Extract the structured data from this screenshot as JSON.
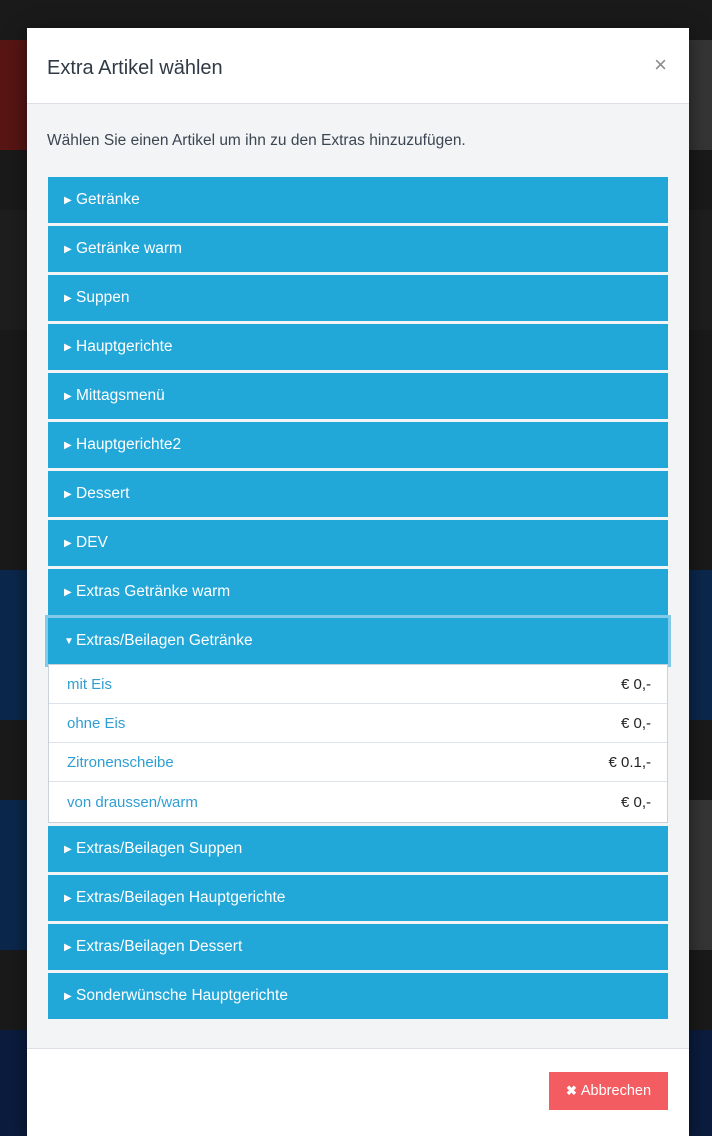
{
  "modal": {
    "title": "Extra Artikel wählen",
    "close_icon": "×",
    "instruction": "Wählen Sie einen Artikel um ihn zu den Extras hinzuzufügen.",
    "categories_before": [
      {
        "label": "Getränke"
      },
      {
        "label": "Getränke warm"
      },
      {
        "label": "Suppen"
      },
      {
        "label": "Hauptgerichte"
      },
      {
        "label": "Mittagsmenü"
      },
      {
        "label": "Hauptgerichte2"
      },
      {
        "label": "Dessert"
      },
      {
        "label": "DEV"
      },
      {
        "label": "Extras Getränke warm"
      }
    ],
    "open_category": {
      "label": "Extras/Beilagen Getränke",
      "items": [
        {
          "name": "mit Eis",
          "price": "€ 0,-"
        },
        {
          "name": "ohne Eis",
          "price": "€ 0,-"
        },
        {
          "name": "Zitronenscheibe",
          "price": "€ 0.1,-"
        },
        {
          "name": "von draussen/warm",
          "price": "€ 0,-"
        }
      ]
    },
    "categories_after": [
      {
        "label": "Extras/Beilagen Suppen"
      },
      {
        "label": "Extras/Beilagen Hauptgerichte"
      },
      {
        "label": "Extras/Beilagen Dessert"
      },
      {
        "label": "Sonderwünsche Hauptgerichte"
      }
    ],
    "cancel_label": "Abbrechen",
    "cancel_icon": "✖"
  },
  "colors": {
    "category_bg": "#22a7d9",
    "cancel_bg": "#f35d61",
    "item_name": "#2f9fd3"
  }
}
